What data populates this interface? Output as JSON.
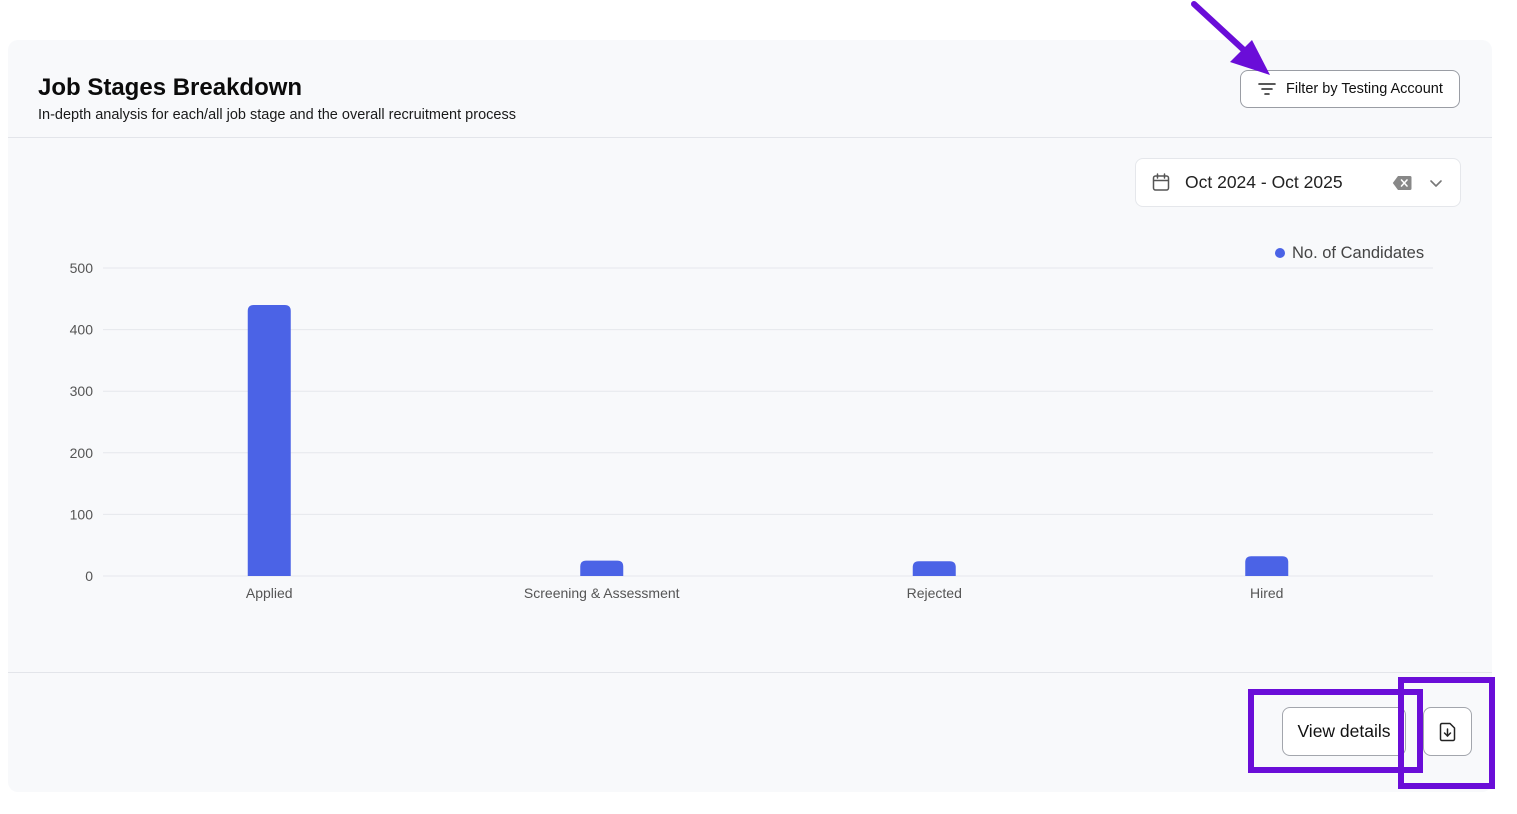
{
  "header": {
    "title": "Job Stages Breakdown",
    "subtitle": "In-depth analysis for each/all job stage and the overall recruitment process",
    "filter_button": {
      "label": "Filter by Testing Account",
      "icon": "filter-lines-icon"
    }
  },
  "date_range": {
    "value": "Oct 2024 - Oct 2025",
    "icon": "calendar-icon",
    "clear_icon": "clear-backspace-icon",
    "dropdown_icon": "chevron-down-icon"
  },
  "chart_data": {
    "type": "bar",
    "categories": [
      "Applied",
      "Screening & Assessment",
      "Rejected",
      "Hired"
    ],
    "series": [
      {
        "name": "No. of Candidates",
        "values": [
          440,
          25,
          24,
          32
        ],
        "color": "#4b63e6"
      }
    ],
    "ylim": [
      0,
      500
    ],
    "yticks": [
      0,
      100,
      200,
      300,
      400,
      500
    ],
    "grid": true,
    "legend_position": "top-right"
  },
  "footer": {
    "view_details_label": "View details",
    "export_icon": "file-download-icon"
  },
  "annotation": {
    "color": "#6a0dd8",
    "arrow": "pointing to filter button",
    "boxes": [
      "view details button",
      "export button"
    ]
  }
}
